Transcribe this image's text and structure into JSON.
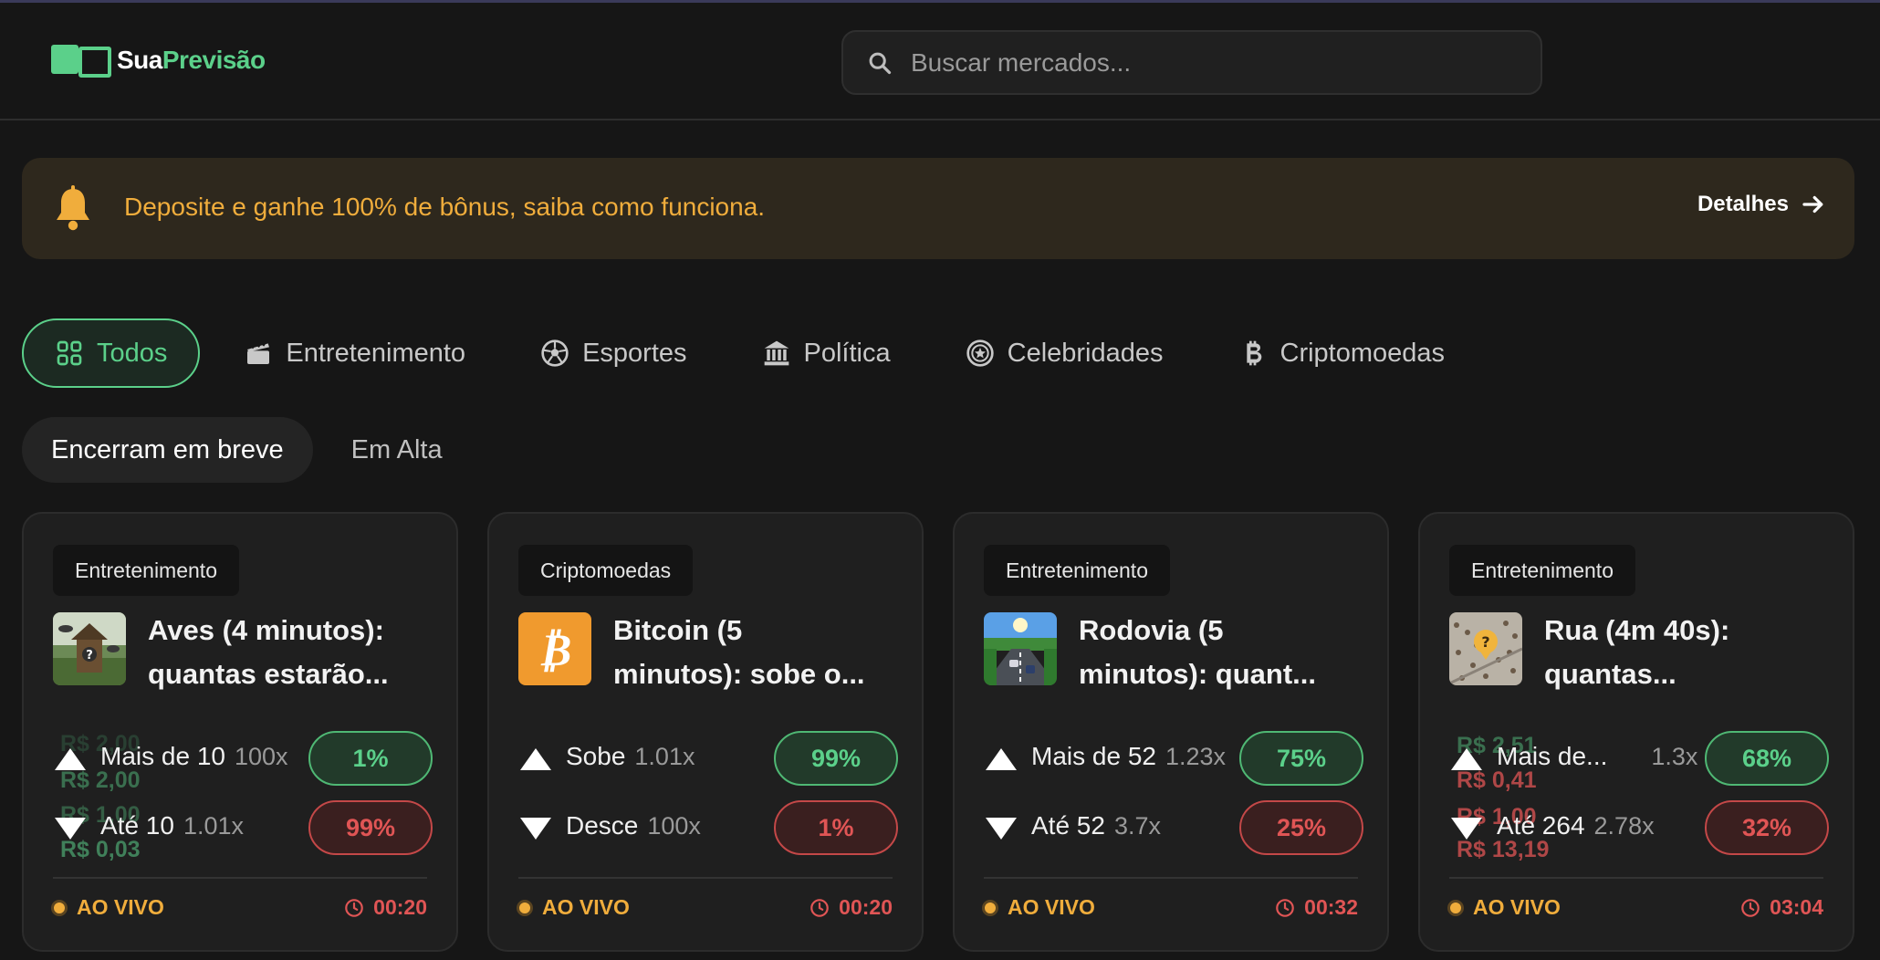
{
  "app": {
    "logo_part1": "Sua",
    "logo_part2": "Previsão",
    "search_placeholder": "Buscar mercados..."
  },
  "banner": {
    "text": "Deposite e ganhe 100% de bônus, saiba como funciona.",
    "details_label": "Detalhes"
  },
  "categories": [
    {
      "label": "Todos",
      "icon": "grid-icon"
    },
    {
      "label": "Entretenimento",
      "icon": "clapperboard-icon"
    },
    {
      "label": "Esportes",
      "icon": "soccer-ball-icon"
    },
    {
      "label": "Política",
      "icon": "government-building-icon"
    },
    {
      "label": "Celebridades",
      "icon": "star-badge-icon"
    },
    {
      "label": "Criptomoedas",
      "icon": "bitcoin-icon"
    }
  ],
  "subtabs": [
    {
      "label": "Encerram em breve"
    },
    {
      "label": "Em Alta"
    }
  ],
  "cards": [
    {
      "category": "Entretenimento",
      "thumb": "birds-thumbnail",
      "title_line1": "Aves (4 minutos):",
      "title_line2": "quantas estarão...",
      "outcomes": [
        {
          "label": "Mais de 10",
          "mult": "100x",
          "pct": "1%"
        },
        {
          "label": "Até 10",
          "mult": "1.01x",
          "pct": "99%"
        }
      ],
      "ghost_values": [
        "R$ 2,00",
        "R$ 2,00",
        "R$ 1,00",
        "R$ 0,03"
      ],
      "status": "AO VIVO",
      "timer": "00:20"
    },
    {
      "category": "Criptomoedas",
      "thumb": "bitcoin-thumbnail",
      "title_line1": "Bitcoin (5",
      "title_line2": "minutos): sobe o...",
      "outcomes": [
        {
          "label": "Sobe",
          "mult": "1.01x",
          "pct": "99%"
        },
        {
          "label": "Desce",
          "mult": "100x",
          "pct": "1%"
        }
      ],
      "status": "AO VIVO",
      "timer": "00:20"
    },
    {
      "category": "Entretenimento",
      "thumb": "highway-thumbnail",
      "title_line1": "Rodovia (5",
      "title_line2": "minutos): quant...",
      "outcomes": [
        {
          "label": "Mais de 52",
          "mult": "1.23x",
          "pct": "75%"
        },
        {
          "label": "Até 52",
          "mult": "3.7x",
          "pct": "25%"
        }
      ],
      "status": "AO VIVO",
      "timer": "00:32"
    },
    {
      "category": "Entretenimento",
      "thumb": "street-thumbnail",
      "title_line1": "Rua (4m 40s):",
      "title_line2": "quantas...",
      "outcomes": [
        {
          "label": "Mais de...",
          "mult": "1.3x",
          "pct": "68%"
        },
        {
          "label": "Até 264",
          "mult": "2.78x",
          "pct": "32%"
        }
      ],
      "ghost_values": [
        "R$ 2,51",
        "R$ 0,41",
        "R$ 1,00",
        "R$ 13,19"
      ],
      "status": "AO VIVO",
      "timer": "03:04"
    }
  ],
  "colors": {
    "accent_green": "#5bd08a",
    "accent_red": "#e05555",
    "accent_orange": "#f0ad3c",
    "background": "#161616"
  }
}
